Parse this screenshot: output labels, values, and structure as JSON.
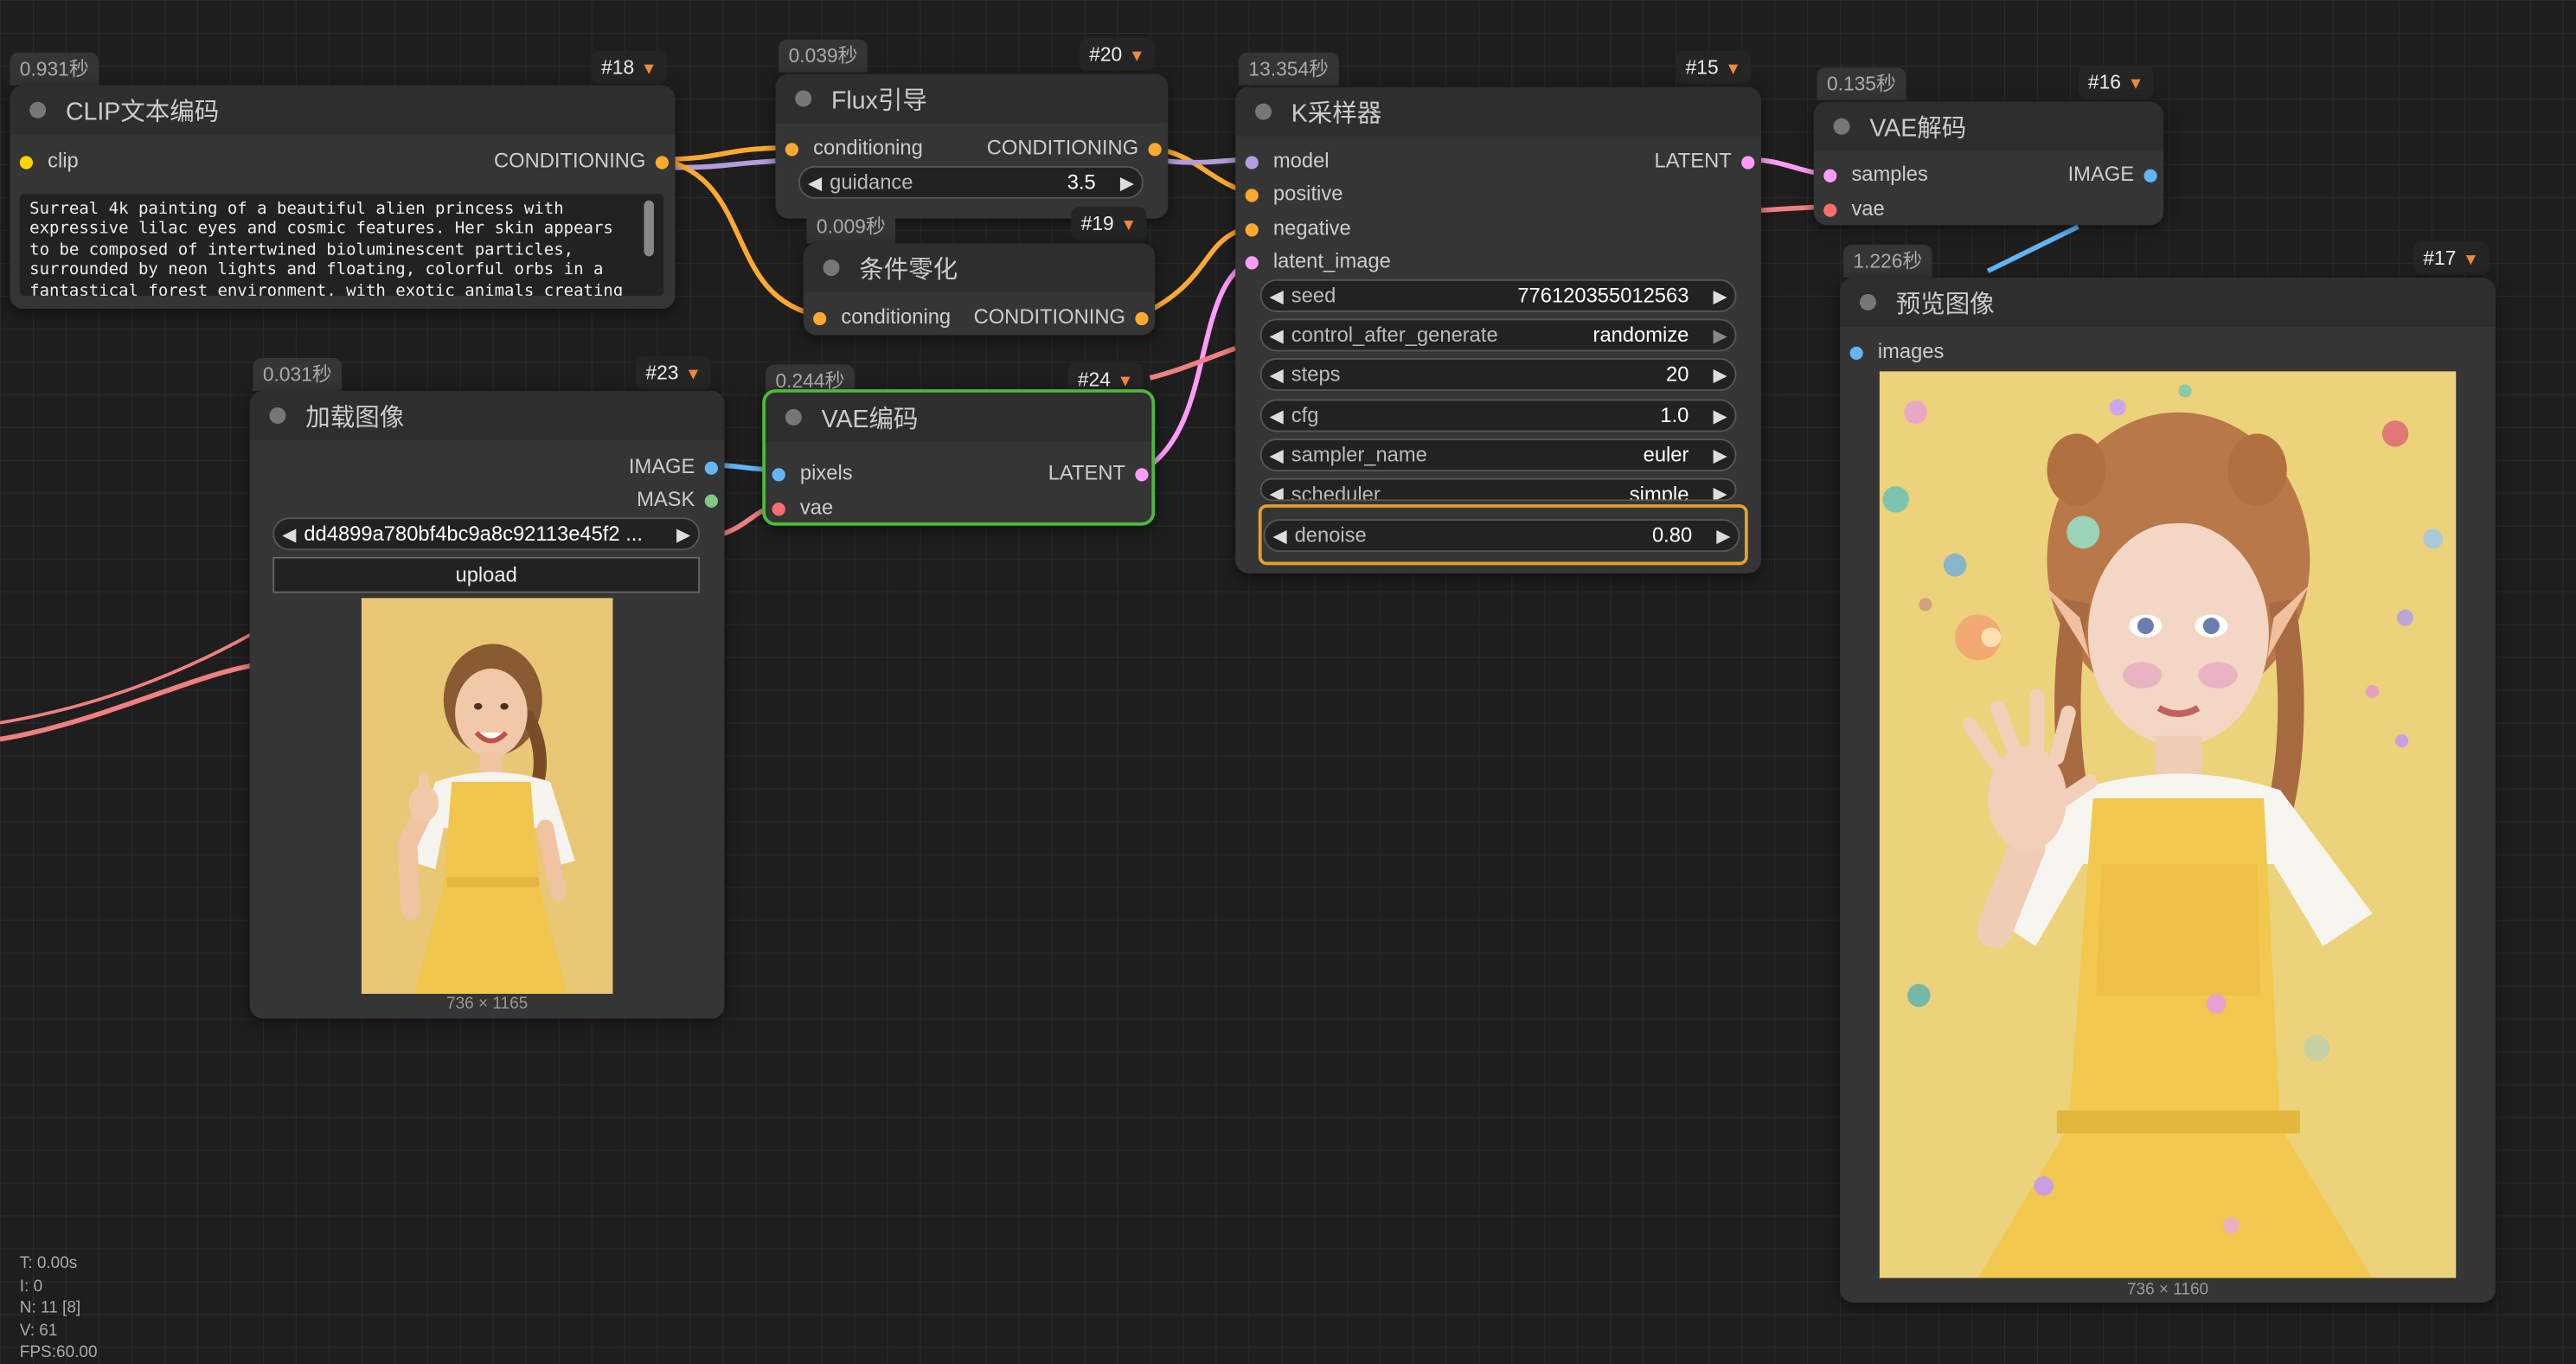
{
  "colors": {
    "canvas_bg": "#1e1e1e",
    "node_bg": "#353535",
    "conditioning": "#ffa931",
    "clip": "#ffd500",
    "image": "#64b5f6",
    "mask": "#81c784",
    "latent": "#ff9cf9",
    "vae": "#ff6e6e",
    "model": "#b39ddb",
    "selected_border": "#4cbb3a",
    "highlight_border": "#e0a030"
  },
  "nodes": {
    "clip": {
      "timing": "0.931秒",
      "badge": "#18",
      "title": "CLIP文本编码",
      "in_clip": "clip",
      "out_conditioning": "CONDITIONING",
      "prompt": "Surreal 4k painting of a beautiful alien princess with\nexpressive lilac eyes and cosmic features. Her skin appears\nto be composed of intertwined bioluminescent particles,\nsurrounded by neon lights and floating, colorful orbs in a\nfantastical forest environment, with exotic animals creating"
    },
    "flux": {
      "timing": "0.039秒",
      "badge": "#20",
      "title": "Flux引导",
      "in_conditioning": "conditioning",
      "out_conditioning": "CONDITIONING",
      "guidance_label": "guidance",
      "guidance_value": "3.5"
    },
    "zero": {
      "timing": "0.009秒",
      "badge": "#19",
      "title": "条件零化",
      "in_conditioning": "conditioning",
      "out_conditioning": "CONDITIONING"
    },
    "load": {
      "timing": "0.031秒",
      "badge": "#23",
      "title": "加载图像",
      "out_image": "IMAGE",
      "out_mask": "MASK",
      "file": "dd4899a780bf4bc9a8c92113e45f2 ...",
      "upload": "upload",
      "dims": "736 × 1165"
    },
    "vaeenc": {
      "timing": "0.244秒",
      "badge": "#24",
      "title": "VAE编码",
      "in_pixels": "pixels",
      "in_vae": "vae",
      "out_latent": "LATENT"
    },
    "ksampler": {
      "timing": "13.354秒",
      "badge": "#15",
      "title": "K采样器",
      "in_model": "model",
      "in_positive": "positive",
      "in_negative": "negative",
      "in_latent": "latent_image",
      "out_latent": "LATENT",
      "widgets": [
        {
          "label": "seed",
          "value": "776120355012563"
        },
        {
          "label": "control_after_generate",
          "value": "randomize"
        },
        {
          "label": "steps",
          "value": "20"
        },
        {
          "label": "cfg",
          "value": "1.0"
        },
        {
          "label": "sampler_name",
          "value": "euler"
        },
        {
          "label": "scheduler",
          "value": "simple"
        },
        {
          "label": "denoise",
          "value": "0.80"
        }
      ]
    },
    "vaedec": {
      "timing": "0.135秒",
      "badge": "#16",
      "title": "VAE解码",
      "in_samples": "samples",
      "in_vae": "vae",
      "out_image": "IMAGE"
    },
    "preview": {
      "timing": "1.226秒",
      "badge": "#17",
      "title": "预览图像",
      "in_images": "images",
      "dims": "736 × 1160"
    }
  },
  "stats": {
    "t": "T: 0.00s",
    "i": "I: 0",
    "n": "N: 11 [8]",
    "v": "V: 61",
    "fps": "FPS:60.00"
  }
}
